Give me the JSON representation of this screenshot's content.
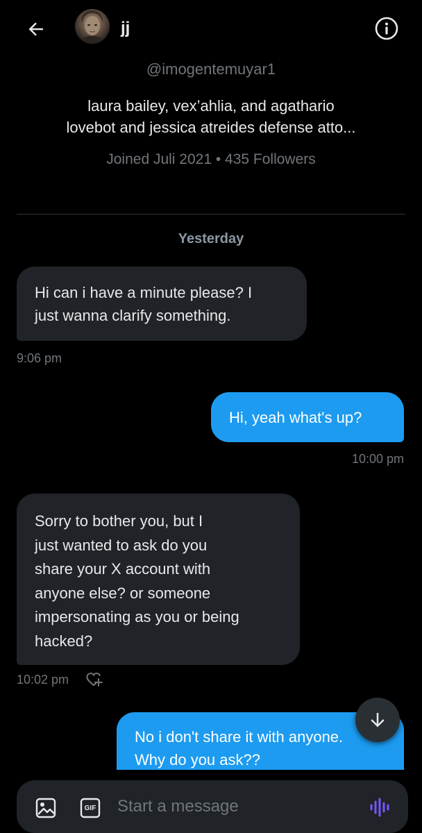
{
  "header": {
    "name": "jj",
    "back_icon": "arrow-left-icon",
    "info_icon": "info-icon"
  },
  "profile": {
    "handle": "@imogentemuyar1",
    "bio_line1": "laura bailey, vex’ahlia, and agathario",
    "bio_line2": "lovebot and jessica atreides defense atto...",
    "meta": "Joined Juli 2021 • 435 Followers"
  },
  "conversation": {
    "day_separator": "Yesterday",
    "messages": [
      {
        "direction": "received",
        "lines": [
          "Hi can i have a minute please? I",
          "just wanna clarify something."
        ],
        "time": "9:06 pm"
      },
      {
        "direction": "sent",
        "lines": [
          "Hi, yeah what's up?"
        ],
        "time": "10:00 pm"
      },
      {
        "direction": "received",
        "lines": [
          "Sorry to bother you, but I",
          "just wanted to ask do you",
          "share your X account with",
          "anyone else? or someone",
          "impersonating as you or being",
          "hacked?"
        ],
        "time": "10:02 pm"
      },
      {
        "direction": "sent",
        "lines": [
          "No i don't share it with anyone.",
          "Why do you ask??"
        ],
        "time": ""
      }
    ]
  },
  "composer": {
    "placeholder": "Start a message",
    "gif_label": "GIF"
  },
  "colors": {
    "background": "#000000",
    "sent_bubble": "#1d9bf0",
    "received_bubble": "#202327",
    "secondary_text": "#71767b",
    "voice_accent": "#7856ff"
  }
}
